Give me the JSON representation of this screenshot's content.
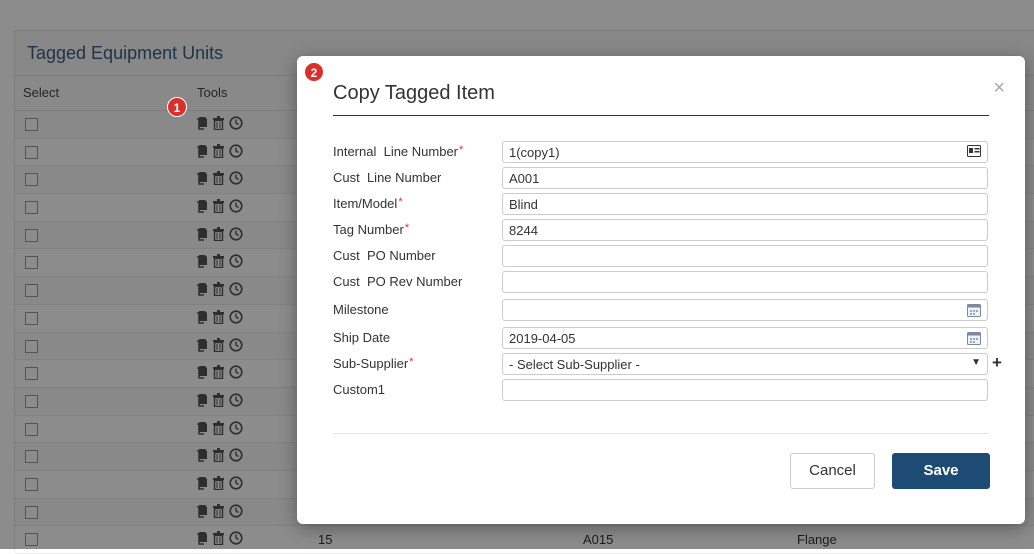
{
  "page": {
    "panel_title": "Tagged Equipment Units",
    "columns": {
      "select": "Select",
      "tools": "Tools"
    },
    "row_count": 16,
    "last_row": {
      "line": "15",
      "cust_line": "A015",
      "item": "Flange"
    }
  },
  "badges": {
    "one": "1",
    "two": "2"
  },
  "modal": {
    "title": "Copy Tagged Item",
    "close": "×",
    "fields": {
      "internal_line": {
        "label": "Internal  Line Number",
        "required": true,
        "value": "1(copy1)"
      },
      "cust_line": {
        "label": "Cust  Line Number",
        "value": "A001"
      },
      "item_model": {
        "label": "Item/Model",
        "required": true,
        "value": "Blind"
      },
      "tag_number": {
        "label": "Tag Number",
        "required": true,
        "value": "8244"
      },
      "cust_po": {
        "label": "Cust  PO Number",
        "value": ""
      },
      "cust_po_rev": {
        "label": "Cust  PO Rev Number",
        "value": ""
      },
      "milestone": {
        "label": "Milestone",
        "value": ""
      },
      "ship_date": {
        "label": "Ship Date",
        "value": "2019-04-05"
      },
      "sub_supplier": {
        "label": "Sub-Supplier",
        "required": true,
        "value": "- Select Sub-Supplier -"
      },
      "custom1": {
        "label": "Custom1",
        "value": ""
      }
    },
    "required_mark": "*",
    "plus": "+",
    "cancel": "Cancel",
    "save": "Save"
  },
  "colors": {
    "accent": "#1e4b74",
    "badge": "#d9302c",
    "title": "#3a5f84"
  }
}
